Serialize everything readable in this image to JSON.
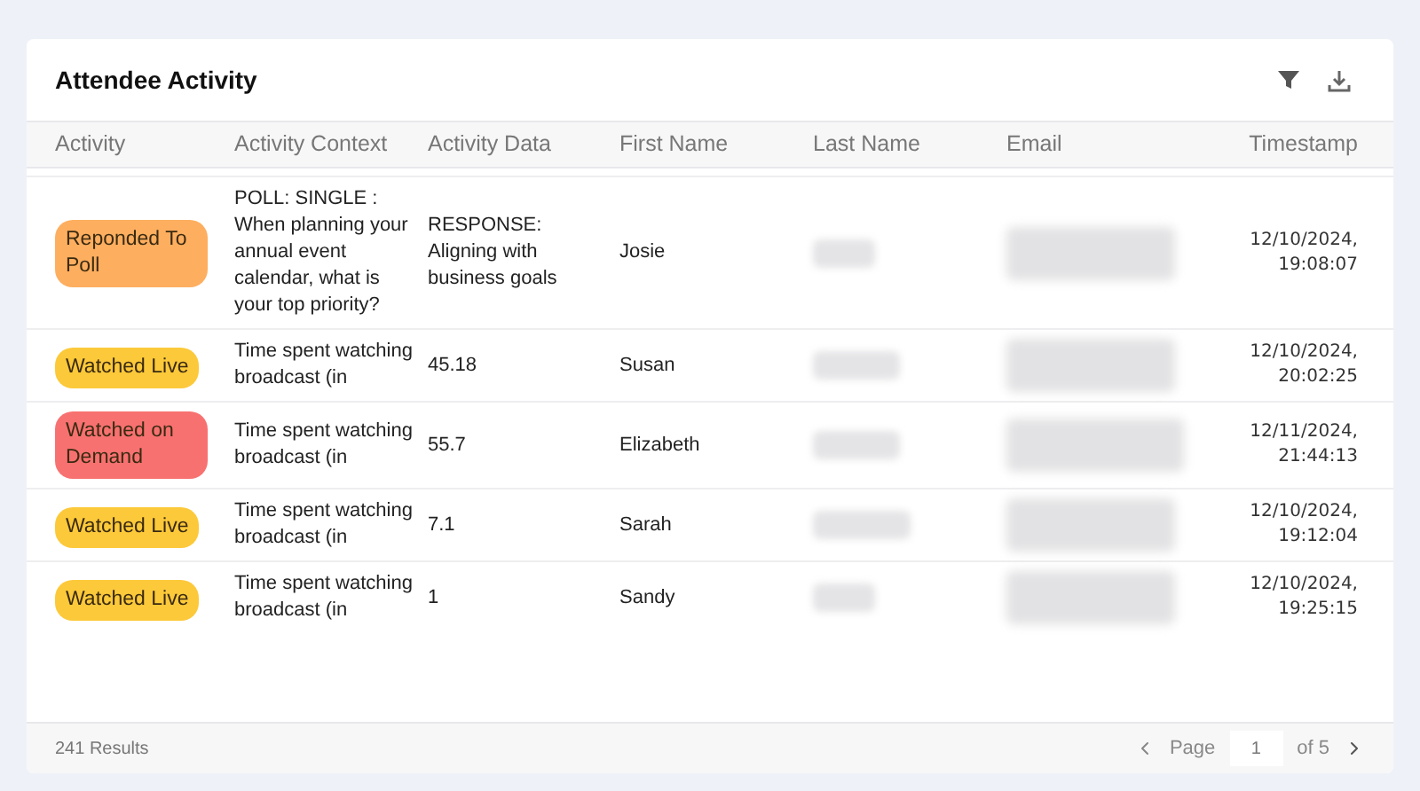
{
  "title": "Attendee Activity",
  "columns": [
    "Activity",
    "Activity Context",
    "Activity Data",
    "First Name",
    "Last Name",
    "Email",
    "Timestamp"
  ],
  "rows": [
    {
      "activity": {
        "label": "Reponded To Poll",
        "color": "#fdae5f"
      },
      "context": "POLL: SINGLE : When planning your annual event calendar, what is your top priority?",
      "data": "RESPONSE: Aligning with business goals",
      "first_name": "Josie",
      "timestamp": [
        "12/10/2024,",
        "19:08:07"
      ]
    },
    {
      "activity": {
        "label": "Watched Live",
        "color": "#fcc93a"
      },
      "context": "Time spent watching broadcast (in",
      "data": "45.18",
      "first_name": "Susan",
      "timestamp": [
        "12/10/2024,",
        "20:02:25"
      ]
    },
    {
      "activity": {
        "label": "Watched on Demand",
        "color": "#f87171"
      },
      "context": "Time spent watching broadcast (in",
      "data": "55.7",
      "first_name": "Elizabeth",
      "timestamp": [
        "12/11/2024,",
        "21:44:13"
      ]
    },
    {
      "activity": {
        "label": "Watched Live",
        "color": "#fcc93a"
      },
      "context": "Time spent watching broadcast (in",
      "data": "7.1",
      "first_name": "Sarah",
      "timestamp": [
        "12/10/2024,",
        "19:12:04"
      ]
    },
    {
      "activity": {
        "label": "Watched Live",
        "color": "#fcc93a"
      },
      "context": "Time spent watching broadcast (in",
      "data": "1",
      "first_name": "Sandy",
      "timestamp": [
        "12/10/2024,",
        "19:25:15"
      ]
    }
  ],
  "footer": {
    "results": "241 Results",
    "page_label": "Page",
    "page": "1",
    "of": "of 5"
  }
}
